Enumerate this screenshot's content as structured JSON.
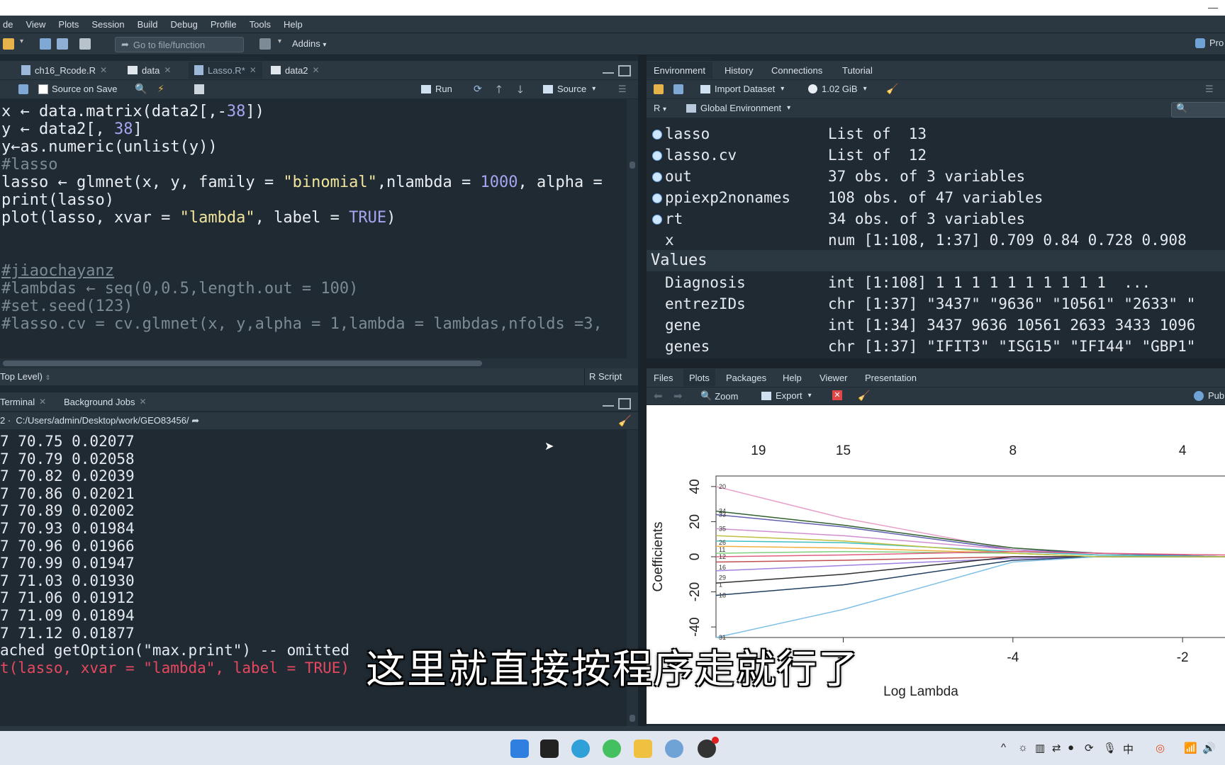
{
  "menu": [
    "de",
    "View",
    "Plots",
    "Session",
    "Build",
    "Debug",
    "Profile",
    "Tools",
    "Help"
  ],
  "toolbar": {
    "goto_placeholder": "Go to file/function",
    "addins": "Addins",
    "project": "Pro"
  },
  "editor": {
    "tabs": [
      {
        "label": "ch16_Rcode.R"
      },
      {
        "label": "data"
      },
      {
        "label": "Lasso.R*"
      },
      {
        "label": "data2"
      }
    ],
    "source_on_save": "Source on Save",
    "run": "Run",
    "source": "Source",
    "status_scope": "Top Level)",
    "status_type": "R Script",
    "lines": [
      [
        "x ← data.matrix(data2[,-",
        {
          "n": "38"
        },
        "])"
      ],
      [
        "y ← data2[, ",
        {
          "n": "38"
        },
        "]"
      ],
      [
        "y←as.numeric(unlist(y))"
      ],
      [
        {
          "c": "#lasso"
        }
      ],
      [
        "lasso ← glmnet(x, y, family = ",
        {
          "s": "\"binomial\""
        },
        ",nlambda = ",
        {
          "n": "1000"
        },
        ", alpha ="
      ],
      [
        "print(lasso)"
      ],
      [
        "plot(lasso, xvar = ",
        {
          "s": "\"lambda\""
        },
        ", label = ",
        {
          "n": "TRUE"
        },
        ")"
      ],
      [
        ""
      ],
      [
        ""
      ],
      [
        {
          "c": "#jiaochayanz"
        }
      ],
      [
        {
          "c": "#lambdas ← seq(0,0.5,length.out = 100)"
        }
      ],
      [
        {
          "c": "#set.seed(123)"
        }
      ],
      [
        {
          "c": "#lasso.cv = cv.glmnet(x, y,alpha = 1,lambda = lambdas,nfolds =3,"
        }
      ]
    ]
  },
  "console": {
    "tabs": [
      {
        "label": "Terminal"
      },
      {
        "label": "Background Jobs"
      }
    ],
    "path": "C:/Users/admin/Desktop/work/GEO83456/",
    "path_prefix": "2",
    "lines": [
      "7 70.75 0.02077",
      "7 70.79 0.02058",
      "7 70.82 0.02039",
      "7 70.86 0.02021",
      "7 70.89 0.02002",
      "7 70.93 0.01984",
      "7 70.96 0.01966",
      "7 70.99 0.01947",
      "7 71.03 0.01930",
      "7 71.06 0.01912",
      "7 71.09 0.01894",
      "7 71.12 0.01877",
      "ached getOption(\"max.print\") -- omitted"
    ],
    "command": "t(lasso, xvar = \"lambda\", label = TRUE)"
  },
  "environment": {
    "tabs": [
      {
        "label": "Environment"
      },
      {
        "label": "History"
      },
      {
        "label": "Connections"
      },
      {
        "label": "Tutorial"
      }
    ],
    "import_dataset": "Import Dataset",
    "memory": "1.02 GiB",
    "lang": "R",
    "scope": "Global Environment",
    "data_rows": [
      {
        "name": "lasso",
        "value": "List of  13"
      },
      {
        "name": "lasso.cv",
        "value": "List of  12"
      },
      {
        "name": "out",
        "value": "37 obs. of 3 variables"
      },
      {
        "name": "ppiexp2nonames",
        "value": "108 obs. of 47 variables"
      },
      {
        "name": "rt",
        "value": "34 obs. of 3 variables"
      },
      {
        "name": "x",
        "value": "num [1:108, 1:37] 0.709 0.84 0.728 0.908"
      }
    ],
    "values_header": "Values",
    "value_rows": [
      {
        "name": "Diagnosis",
        "value": "int [1:108] 1 1 1 1 1 1 1 1 1 1  ..."
      },
      {
        "name": "entrezIDs",
        "value": "chr [1:37] \"3437\" \"9636\" \"10561\" \"2633\" \""
      },
      {
        "name": "gene",
        "value": "int [1:34] 3437 9636 10561 2633 3433 1096"
      },
      {
        "name": "genes",
        "value": "chr [1:37] \"IFIT3\" \"ISG15\" \"IFI44\" \"GBP1\""
      }
    ]
  },
  "files": {
    "tabs": [
      {
        "label": "Files"
      },
      {
        "label": "Plots"
      },
      {
        "label": "Packages"
      },
      {
        "label": "Help"
      },
      {
        "label": "Viewer"
      },
      {
        "label": "Presentation"
      }
    ],
    "zoom": "Zoom",
    "export": "Export",
    "publish": "Pub"
  },
  "chart_data": {
    "type": "line",
    "title": "",
    "xlabel": "Log Lambda",
    "ylabel": "Coefficients",
    "xlim": [
      -7.5,
      -1.5
    ],
    "ylim": [
      -46,
      46
    ],
    "xticks": [
      -6,
      -4,
      -2
    ],
    "yticks": [
      -40,
      -20,
      0,
      20,
      40
    ],
    "top_axis_labels": [
      {
        "x": -7.0,
        "label": "19"
      },
      {
        "x": -6.0,
        "label": "15"
      },
      {
        "x": -4.0,
        "label": "8"
      },
      {
        "x": -2.0,
        "label": "4"
      }
    ],
    "left_labels": [
      {
        "y": 40,
        "label": "20"
      },
      {
        "y": 26,
        "label": "34"
      },
      {
        "y": 24,
        "label": "33"
      },
      {
        "y": 16,
        "label": "35"
      },
      {
        "y": 8,
        "label": "26"
      },
      {
        "y": 4,
        "label": "11"
      },
      {
        "y": 0,
        "label": "12"
      },
      {
        "y": -6,
        "label": "16"
      },
      {
        "y": -12,
        "label": "29"
      },
      {
        "y": -16,
        "label": "1"
      },
      {
        "y": -22,
        "label": "18"
      },
      {
        "y": -46,
        "label": "31"
      }
    ],
    "series": [
      {
        "color": "#e8a0c8",
        "x": [
          -7.5,
          -6,
          -4,
          -3,
          -1.5
        ],
        "y": [
          40,
          22,
          4,
          1,
          0
        ]
      },
      {
        "color": "#2f5f2f",
        "x": [
          -7.5,
          -6,
          -4,
          -3,
          -1.5
        ],
        "y": [
          26,
          18,
          5,
          2,
          0
        ]
      },
      {
        "color": "#6060b0",
        "x": [
          -7.5,
          -6,
          -4,
          -3,
          -1.5
        ],
        "y": [
          24,
          17,
          4,
          2,
          0
        ]
      },
      {
        "color": "#d090d0",
        "x": [
          -7.5,
          -6,
          -4,
          -3,
          -1.5
        ],
        "y": [
          16,
          12,
          4,
          1,
          0
        ]
      },
      {
        "color": "#40c0c0",
        "x": [
          -7.5,
          -6,
          -4,
          -3,
          -1.5
        ],
        "y": [
          9,
          8,
          3,
          1,
          0
        ]
      },
      {
        "color": "#f0b040",
        "x": [
          -7.5,
          -6,
          -4,
          -3,
          -1.5
        ],
        "y": [
          6,
          5,
          2,
          0,
          0
        ]
      },
      {
        "color": "#80d080",
        "x": [
          -7.5,
          -6,
          -4,
          -3,
          -1.5
        ],
        "y": [
          2,
          3,
          2,
          0,
          0
        ]
      },
      {
        "color": "#c05050",
        "x": [
          -7.5,
          -6,
          -4,
          -3,
          -1.5
        ],
        "y": [
          -3,
          -2,
          0,
          0,
          0
        ]
      },
      {
        "color": "#a080e0",
        "x": [
          -7.5,
          -6,
          -4,
          -3,
          -1.5
        ],
        "y": [
          -8,
          -5,
          -1,
          0,
          0
        ]
      },
      {
        "color": "#303030",
        "x": [
          -7.5,
          -6,
          -4,
          -3,
          -1.5
        ],
        "y": [
          -15,
          -10,
          0,
          0,
          0
        ]
      },
      {
        "color": "#204060",
        "x": [
          -7.5,
          -6,
          -4,
          -3,
          -1.5
        ],
        "y": [
          -22,
          -16,
          -2,
          0,
          0
        ]
      },
      {
        "color": "#80c0e8",
        "x": [
          -7.5,
          -6,
          -4,
          -3,
          -1.5
        ],
        "y": [
          -46,
          -30,
          -3,
          0,
          0
        ]
      },
      {
        "color": "#c0c040",
        "x": [
          -7.5,
          -6,
          -4,
          -3,
          -1.5
        ],
        "y": [
          12,
          9,
          2,
          0,
          0
        ]
      },
      {
        "color": "#e06080",
        "x": [
          -7.5,
          -6,
          -4,
          -3,
          -1.5
        ],
        "y": [
          0,
          1,
          3,
          2,
          1
        ]
      }
    ]
  },
  "subtitle": "这里就直接按程序走就行了",
  "taskbar": {
    "apps": [
      "windows-start",
      "terminal",
      "edge",
      "wechat",
      "folder",
      "rstudio",
      "app-red"
    ]
  }
}
